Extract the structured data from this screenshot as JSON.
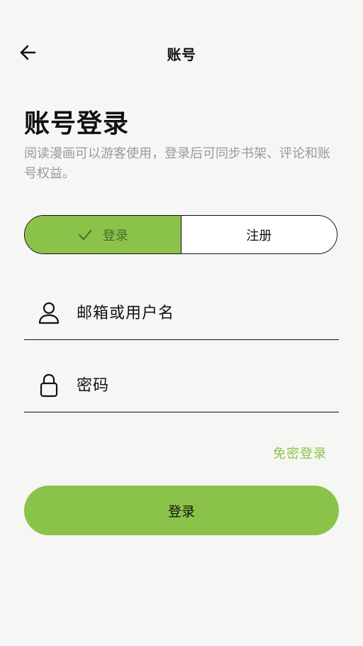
{
  "header": {
    "title": "账号",
    "back_icon": "arrow-left-icon"
  },
  "heading": "账号登录",
  "subtitle": "阅读漫画可以游客使用，登录后可同步书架、评论和账号权益。",
  "segmented": {
    "login_label": "登录",
    "register_label": "注册",
    "selected": "登录",
    "check_icon": "check-icon"
  },
  "fields": {
    "username": {
      "placeholder": "邮箱或用户名",
      "value": "",
      "icon": "user-icon"
    },
    "password": {
      "placeholder": "密码",
      "value": "",
      "icon": "lock-icon"
    }
  },
  "passwordless_label": "免密登录",
  "submit_label": "登录",
  "colors": {
    "accent": "#8bc34a",
    "background": "#f6f6f4",
    "text": "#111111",
    "muted": "#9a9a9a"
  }
}
